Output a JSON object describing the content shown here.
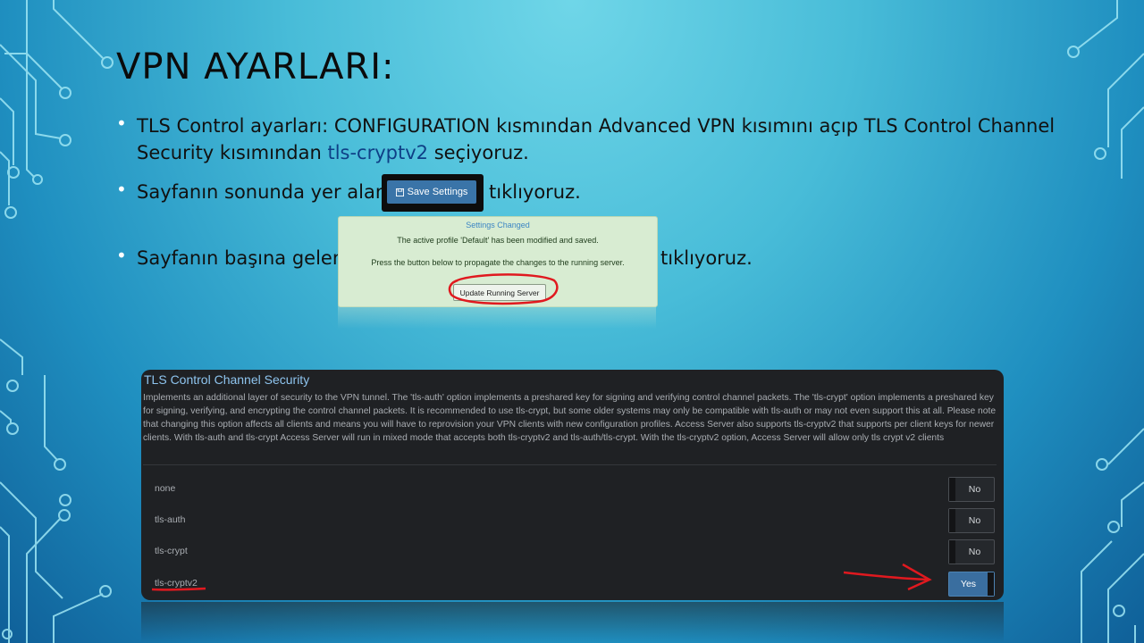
{
  "slide": {
    "title": "VPN AYARLARI:",
    "bullets": [
      {
        "part1": "TLS Control ayarları: CONFIGURATION  kısmından Advanced VPN kısımını açıp TLS Control Channel",
        "part2": "Security  kısımından ",
        "highlight": "tls-cryptv2",
        "part3": " seçiyoruz."
      },
      {
        "before": "Sayfanın sonunda yer alan",
        "after": "tıklıyoruz."
      },
      {
        "before": "Sayfanın başına gelen",
        "after": "tıklıyoruz."
      }
    ],
    "save_button": {
      "label": "Save Settings",
      "icon": "floppy-icon"
    },
    "settings_notice": {
      "title": "Settings Changed",
      "line1": "The active profile 'Default' has been modified and saved.",
      "line2": "Press the button below to propagate the changes to the running server.",
      "button": "Update Running Server"
    }
  },
  "panel": {
    "title": "TLS Control Channel Security",
    "description": "Implements an additional layer of security to the VPN tunnel. The 'tls-auth' option implements a preshared key for signing and verifying control channel packets. The 'tls-crypt' option implements a preshared key for signing, verifying, and encrypting the control channel packets. It is recommended to use tls-crypt, but some older systems may only be compatible with tls-auth or may not even support this at all. Please note that changing this option affects all clients and means you will have to reprovision your VPN clients with new configuration profiles. Access Server also supports tls-cryptv2 that supports per client keys for newer clients. With tls-auth and tls-crypt Access Server will run in mixed mode that accepts both tls-cryptv2 and tls-auth/tls-crypt. With the tls-cryptv2 option, Access Server will allow only tls crypt v2 clients",
    "options": [
      {
        "label": "none",
        "state": "No"
      },
      {
        "label": "tls-auth",
        "state": "No"
      },
      {
        "label": "tls-crypt",
        "state": "No"
      },
      {
        "label": "tls-cryptv2",
        "state": "Yes"
      }
    ]
  },
  "colors": {
    "accent_blue": "#3a6e9f",
    "annotation_red": "#e0191f",
    "notice_green": "#d8ecd2",
    "highlight_text": "#0e3f86"
  }
}
